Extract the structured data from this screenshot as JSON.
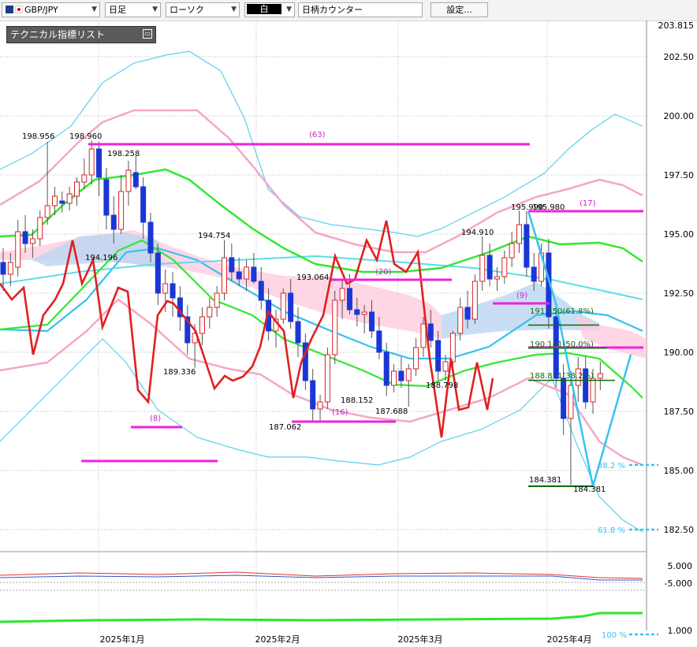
{
  "toolbar": {
    "symbol": "GBP/JPY",
    "timeframe": "日足",
    "chart_style": "ローソク",
    "candle_color": "白",
    "counter": "日柄カウンター",
    "settings": "設定..."
  },
  "indicator_panel": {
    "title": "テクニカル指標リスト"
  },
  "chart_data": {
    "type": "candlestick",
    "y_axis_ticks": [
      "203.815",
      "202.50",
      "200.00",
      "197.50",
      "195.00",
      "192.50",
      "190.00",
      "187.50",
      "185.00",
      "182.50"
    ],
    "x_axis_labels": [
      "2025年1月",
      "2025年2月",
      "2025年3月",
      "2025年4月"
    ],
    "sub_axis_ticks": [
      "5.000",
      "-5.000",
      "1.000"
    ],
    "price_labels": [
      "198.956",
      "198.960",
      "198.258",
      "194.196",
      "194.754",
      "189.336",
      "193.064",
      "188.152",
      "187.688",
      "187.062",
      "188.798",
      "194.910",
      "195.990",
      "195.980",
      "184.381",
      "184.381"
    ],
    "count_labels": [
      "(63)",
      "(8)",
      "(16)",
      "(20)",
      "(9)",
      "(17)"
    ],
    "fibonacci": [
      {
        "label": "191.150(61.8%)",
        "value": 191.15
      },
      {
        "label": "190.181(50.0%)",
        "value": 190.181
      },
      {
        "label": "188.811(38.2%)",
        "value": 188.811
      }
    ],
    "fib_pct_labels": [
      "38.2 %",
      "61.8 %",
      "100 %"
    ],
    "ohlc": [
      [
        193.8,
        194.4,
        192.6,
        193.3
      ],
      [
        193.3,
        194.2,
        192.8,
        193.8
      ],
      [
        193.6,
        195.6,
        193.2,
        195.1
      ],
      [
        195.1,
        195.8,
        194.2,
        194.6
      ],
      [
        194.6,
        195.2,
        194.0,
        194.8
      ],
      [
        194.8,
        196.0,
        194.5,
        195.7
      ],
      [
        195.7,
        198.9,
        195.4,
        196.2
      ],
      [
        196.2,
        197.0,
        195.8,
        196.6
      ],
      [
        196.4,
        196.8,
        195.9,
        196.3
      ],
      [
        196.3,
        197.0,
        196.0,
        196.7
      ],
      [
        196.6,
        197.4,
        196.2,
        197.2
      ],
      [
        197.2,
        198.2,
        196.9,
        197.5
      ],
      [
        197.5,
        198.96,
        197.1,
        198.6
      ],
      [
        198.6,
        198.9,
        196.6,
        197.4
      ],
      [
        197.3,
        197.8,
        195.2,
        195.8
      ],
      [
        195.8,
        196.6,
        194.6,
        195.2
      ],
      [
        195.2,
        197.5,
        195.0,
        196.8
      ],
      [
        196.8,
        198.1,
        196.2,
        197.7
      ],
      [
        197.6,
        198.3,
        196.9,
        197.0
      ],
      [
        197.0,
        197.4,
        194.8,
        195.5
      ],
      [
        195.5,
        195.9,
        193.8,
        194.2
      ],
      [
        194.2,
        194.6,
        192.0,
        192.5
      ],
      [
        192.5,
        193.5,
        191.7,
        192.9
      ],
      [
        192.9,
        193.4,
        191.5,
        192.3
      ],
      [
        192.3,
        192.8,
        190.9,
        191.5
      ],
      [
        191.5,
        192.0,
        189.9,
        190.4
      ],
      [
        190.4,
        191.2,
        189.34,
        190.8
      ],
      [
        190.8,
        191.9,
        190.3,
        191.5
      ],
      [
        191.5,
        192.3,
        191.0,
        191.9
      ],
      [
        191.9,
        192.8,
        191.5,
        192.5
      ],
      [
        192.5,
        194.75,
        192.2,
        194.0
      ],
      [
        194.0,
        194.6,
        193.0,
        193.4
      ],
      [
        193.4,
        194.0,
        192.8,
        193.1
      ],
      [
        193.1,
        193.9,
        192.6,
        193.6
      ],
      [
        193.6,
        194.2,
        192.9,
        193.0
      ],
      [
        193.0,
        193.6,
        191.8,
        192.2
      ],
      [
        192.2,
        192.7,
        190.5,
        190.9
      ],
      [
        190.9,
        191.8,
        190.2,
        191.4
      ],
      [
        191.4,
        192.7,
        191.2,
        192.5
      ],
      [
        192.5,
        193.1,
        191.0,
        191.3
      ],
      [
        191.3,
        191.9,
        189.8,
        190.4
      ],
      [
        190.4,
        190.8,
        188.4,
        188.8
      ],
      [
        188.8,
        189.3,
        187.06,
        187.6
      ],
      [
        187.6,
        188.2,
        187.1,
        187.9
      ],
      [
        187.9,
        190.2,
        187.6,
        189.9
      ],
      [
        189.9,
        192.6,
        189.5,
        192.2
      ],
      [
        192.2,
        193.06,
        191.4,
        192.7
      ],
      [
        192.7,
        193.3,
        191.6,
        191.8
      ],
      [
        191.8,
        192.3,
        191.1,
        191.6
      ],
      [
        191.6,
        192.0,
        190.8,
        191.7
      ],
      [
        191.7,
        192.2,
        190.6,
        190.9
      ],
      [
        190.9,
        191.5,
        189.7,
        190.0
      ],
      [
        190.0,
        190.4,
        188.15,
        188.6
      ],
      [
        188.6,
        189.5,
        188.3,
        189.2
      ],
      [
        189.2,
        189.8,
        188.5,
        188.8
      ],
      [
        188.8,
        189.5,
        187.7,
        189.3
      ],
      [
        189.3,
        190.6,
        189.0,
        190.2
      ],
      [
        190.2,
        191.5,
        189.8,
        191.2
      ],
      [
        191.2,
        191.8,
        190.2,
        190.5
      ],
      [
        190.5,
        190.9,
        188.8,
        189.2
      ],
      [
        189.2,
        189.9,
        188.8,
        189.6
      ],
      [
        189.6,
        190.9,
        189.3,
        190.8
      ],
      [
        190.8,
        192.3,
        190.5,
        191.9
      ],
      [
        191.9,
        192.6,
        191.0,
        191.4
      ],
      [
        191.4,
        193.3,
        191.2,
        193.0
      ],
      [
        193.0,
        194.91,
        192.6,
        194.1
      ],
      [
        194.1,
        194.6,
        192.8,
        193.1
      ],
      [
        193.1,
        193.6,
        192.6,
        193.2
      ],
      [
        193.2,
        194.3,
        192.9,
        194.0
      ],
      [
        194.0,
        195.1,
        193.6,
        194.6
      ],
      [
        194.6,
        195.99,
        194.2,
        195.4
      ],
      [
        195.4,
        195.98,
        193.2,
        193.6
      ],
      [
        193.6,
        194.2,
        192.6,
        193.0
      ],
      [
        193.0,
        194.6,
        192.8,
        194.2
      ],
      [
        194.2,
        194.8,
        191.0,
        191.5
      ],
      [
        191.5,
        191.9,
        188.5,
        188.9
      ],
      [
        188.9,
        189.5,
        186.5,
        187.2
      ],
      [
        187.2,
        189.2,
        184.38,
        188.6
      ],
      [
        188.6,
        189.8,
        187.9,
        189.3
      ],
      [
        189.3,
        189.8,
        187.6,
        187.9
      ],
      [
        187.9,
        189.3,
        187.4,
        188.9
      ],
      [
        188.9,
        189.6,
        188.4,
        189.1
      ]
    ]
  }
}
